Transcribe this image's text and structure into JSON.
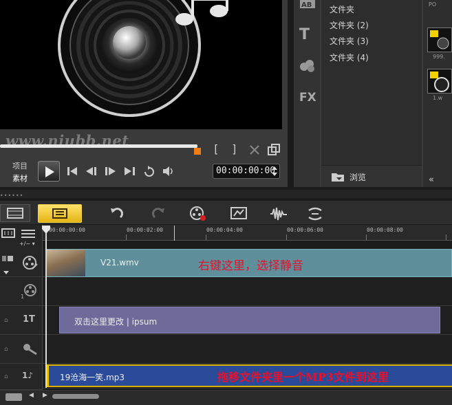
{
  "preview": {
    "watermark": "www.niubb.net",
    "label_project": "项目",
    "label_clip": "素材",
    "mark_in": "[",
    "mark_out": "]",
    "timecode": "00:00:00:00",
    "playback_progress": 0.7
  },
  "library": {
    "tab_icons": [
      "transition-icon",
      "title-icon",
      "graphics-icon",
      "filter-icon"
    ],
    "title_tab": "T",
    "filter_tab": "FX",
    "folders": [
      "文件夹",
      "文件夹 (2)",
      "文件夹 (3)",
      "文件夹 (4)"
    ],
    "browse_label": "浏览",
    "thumbs": [
      {
        "label": "999."
      },
      {
        "label": "1.w"
      }
    ],
    "thumb_top_label": "PO",
    "collapse_glyph": "«"
  },
  "splitter": {
    "grip": "••••••"
  },
  "toolbar": {
    "story_view": "storyboard-view-icon",
    "timeline_view": "timeline-view-icon",
    "tools": [
      "undo-icon",
      "redo-icon",
      "record-capture-icon",
      "mixer-icon",
      "audio-waveform-icon",
      "auto-music-icon"
    ]
  },
  "ruler": {
    "ticks": [
      "00:00:00:00",
      "00:00:02:00",
      "00:00:04:00",
      "00:00:06:00",
      "00:00:08:00"
    ],
    "zoom": "+/−  ▾"
  },
  "tracks": {
    "video_clip_name": "V21.wmv",
    "video_note": "右键这里，选择静音",
    "title_clip_text": "双击这里更改 | ipsum",
    "music_clip_name": "19沧海一笑.mp3",
    "music_note": "拖移文件夹里一个MP3文件到这里",
    "overlay_label": "1",
    "title_label": "1T",
    "music_label": "1♪"
  },
  "footer": {
    "left": "◀",
    "right": "▶"
  }
}
